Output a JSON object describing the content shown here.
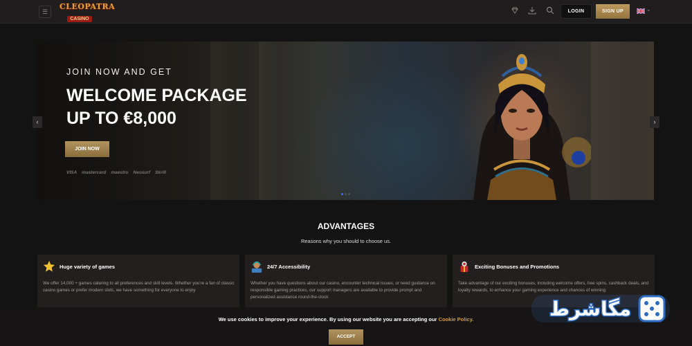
{
  "header": {
    "logo_line1": "CLEOPATRA",
    "logo_line2": "CASINO",
    "login_label": "LOGIN",
    "signup_label": "SIGN UP",
    "icons": [
      "menu-icon",
      "diamond-icon",
      "download-icon",
      "search-icon",
      "uk-flag-icon",
      "chevron-down-icon"
    ]
  },
  "hero": {
    "tag": "JOIN NOW AND GET",
    "title_line1": "WELCOME PACKAGE",
    "title_line2": "UP TO €8,000",
    "cta_label": "JOIN NOW",
    "payments": [
      "VISA",
      "mastercard",
      "maestro",
      "Neosurf",
      "Skrill"
    ],
    "slides_total": 3,
    "active_slide": 1
  },
  "advantages": {
    "title": "ADVANTAGES",
    "subtitle": "Reasons why you should to choose us.",
    "cards": [
      {
        "icon": "star-icon",
        "title": "Huge variety of games",
        "desc": "We offer 14,000 + games catering to all preferences and skill levels. Whether you're a fan of classic casino games or prefer modern slots, we have something for everyone to enjoy"
      },
      {
        "icon": "support-agent-icon",
        "title": "24/7 Accessibility",
        "desc": "Whether you have questions about our casino, encounter technical issues, or need guidance on responsible gaming practices, our support managers are available to provide prompt and personalized assistance round-the-clock"
      },
      {
        "icon": "gift-bonus-icon",
        "title": "Exciting Bonuses and Promotions",
        "desc": "Take advantage of our exciting bonuses, including welcome offers, free spins, cashback deals, and loyalty rewards, to enhance your gaming experience and chances of winning"
      }
    ]
  },
  "cookie": {
    "text": "We use cookies to improve your experience. By using our website you are accepting our",
    "link": "Cookie Policy.",
    "accept_label": "ACCEPT"
  },
  "watermark": {
    "text": "مگاشرط"
  }
}
